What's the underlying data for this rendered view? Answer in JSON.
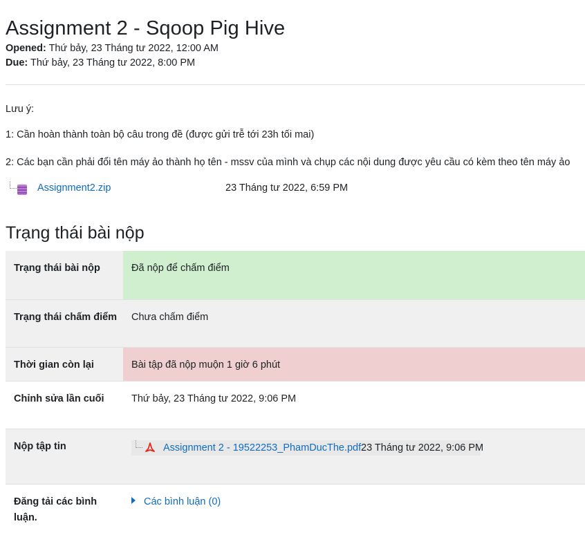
{
  "page": {
    "title": "Assignment 2 - Sqoop Pig Hive",
    "opened_label": "Opened:",
    "opened_value": " Thứ bảy, 23 Tháng tư 2022, 12:00 AM",
    "due_label": "Due:",
    "due_value": " Thứ bảy, 23 Tháng tư 2022, 8:00 PM"
  },
  "intro": {
    "p1": "Lưu ý:",
    "p2": "1: Cần hoàn thành toàn bộ câu trong đề (được gửi trễ tới 23h tối mai)",
    "p3": "2: Các bạn cần phải đổi tên máy ảo thành họ tên - mssv của mình và chụp các nội dung được yêu cầu có kèm theo tên máy ảo",
    "attachment": {
      "name": "Assignment2.zip",
      "timestamp": "23 Tháng tư 2022, 6:59 PM",
      "icon": "zip-archive-icon"
    }
  },
  "status": {
    "heading": "Trạng thái bài nộp",
    "rows": [
      {
        "label": "Trạng thái bài nộp",
        "value": "Đã nộp để chấm điểm"
      },
      {
        "label": "Trạng thái chấm điểm",
        "value": "Chưa chấm điểm"
      },
      {
        "label": "Thời gian còn lại",
        "value": "Bài tập đã nộp muộn 1 giờ 6 phút"
      },
      {
        "label": "Chỉnh sửa lần cuối",
        "value": "Thứ bảy, 23 Tháng tư 2022, 9:06 PM"
      },
      {
        "label": "Nộp tập tin",
        "file_name": "Assignment 2 - 19522253_PhamDucThe.pdf",
        "file_timestamp": "23 Tháng tư 2022, 9:06 PM",
        "icon": "pdf-icon"
      },
      {
        "label": "Đăng tải các bình luận.",
        "value": "Các bình luận (0)",
        "icon": "caret-right-icon"
      }
    ]
  },
  "colors": {
    "link": "#0f6cbf",
    "success_bg": "#cfefcf",
    "danger_bg": "#efcfcf",
    "row_bg": "#f0f0f0"
  }
}
